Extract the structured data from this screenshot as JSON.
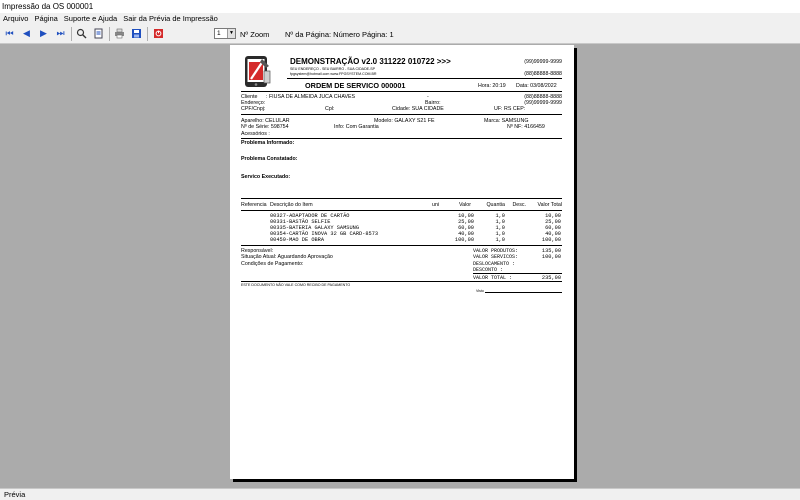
{
  "window": {
    "title": "Impressão da OS 000001"
  },
  "menu": {
    "items": [
      "Arquivo",
      "Página",
      "Suporte e Ajuda",
      "Sair da Prévia de Impressão"
    ]
  },
  "toolbar": {
    "page_value": "1",
    "zoom_label": "Nº Zoom",
    "page_info": "Nº da Página: Número Página: 1"
  },
  "status": {
    "text": "Prévia"
  },
  "report": {
    "company": "DEMONSTRAÇÃO v2.0 311222 010722 >>>",
    "address": "SEU ENDEREÇO - SEU BAIRRO - SUA CIDADE-SP",
    "email": "fpgsystem@hotmail.com  www.FPGSYSTEM.COM.BR",
    "phone1": "(99)99999-9999",
    "phone2": "(88)88888-8888",
    "title": "ORDEM DE SERVICO 000001",
    "hora": "Hora: 20:19",
    "data": "Data: 03/08/2022",
    "cliente_label": "Cliente",
    "cliente": ": FIUSA DE ALMEIDA JUCA CHAVES",
    "endereco": "Endereço:",
    "dash": "-",
    "bairro": "Bairro:",
    "cli_phone1": "(88)88888-8888",
    "cli_phone2": "(99)99999-9999",
    "cpf": "CPF/Cnpj:",
    "cpl": "Cpl:",
    "cidade": "Cidade: SUA CIDADE",
    "uf": "UF: RS  CEP:",
    "aparelho": "Aparelho: CELULAR",
    "modelo": "Modelo: GALAXY S21 FE",
    "marca": "Marca: SAMSUNG",
    "serie": "Nº de Série: 598754",
    "info": "Info: Com Garantia",
    "nf": "Nº NF: 4166459",
    "acessorios": "Acessórios :",
    "problema_informado": "Problema Informado:",
    "problema_constatado": "Problema Constatado:",
    "servico_executado": "Servico Executado:",
    "columns": {
      "ref": "Referencia",
      "desc": "Descrição do Item",
      "uni": "uni",
      "valor": "Valor",
      "qtd": "Quantia",
      "desc2": "Desc.",
      "total": "Valor Total"
    },
    "items": [
      {
        "desc": "00327-ADAPTADOR DE CARTÃO",
        "valor": "10,00",
        "qtd": "1,0",
        "total": "10,00"
      },
      {
        "desc": "00331-BASTÃO SELFIE",
        "valor": "25,00",
        "qtd": "1,0",
        "total": "25,00"
      },
      {
        "desc": "00335-BATERIA GALAXY SAMSUNG",
        "valor": "60,00",
        "qtd": "1,0",
        "total": "60,00"
      },
      {
        "desc": "00354-CARTÃO INOVA 32 GB CARD-8573",
        "valor": "40,00",
        "qtd": "1,0",
        "total": "40,00"
      },
      {
        "desc": "00459-MAO DE OBRA",
        "valor": "100,00",
        "qtd": "1,0",
        "total": "100,00"
      }
    ],
    "responsavel": "Responsável:",
    "situacao": "Situação Atual: Aguardando Aprovação",
    "condicoes": "Condições de Pagamento:",
    "totals": [
      {
        "label": "VALOR PRODUTOS:",
        "value": "135,00"
      },
      {
        "label": "VALOR SERVICOS:",
        "value": "100,00"
      },
      {
        "label": "DESLOCAMENTO  :",
        "value": ""
      },
      {
        "label": "DESCONTO      :",
        "value": ""
      },
      {
        "label": "VALOR TOTAL   :",
        "value": "235,00"
      }
    ],
    "disclaimer": "ESTE DOCUMENTO NÃO VALE COMO RECIBO DE PAGAMENTO",
    "visto": "Visto"
  },
  "colors": {
    "workspace": "#ababab",
    "chrome": "#f0f0f0",
    "logo_red": "#d42a2a",
    "icon_blue": "#1f4fbf"
  }
}
